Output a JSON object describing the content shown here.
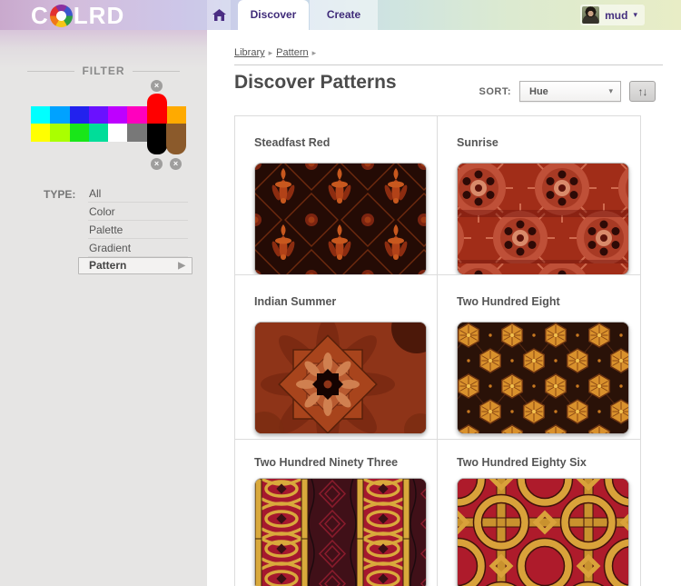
{
  "colors": {
    "accent_purple": "#3f2b79",
    "sidebar_bg": "#e6e5e4",
    "header_gradient": [
      "#c9a9cd",
      "#cdc6e8",
      "#c7d6ea",
      "#cfe4e0",
      "#e8edc6"
    ],
    "grid_border": "#dcdcdc"
  },
  "icons": {
    "close": "×",
    "dropdown_arrow": "▾",
    "user_arrow": "▾",
    "sort_direction": "↑↓",
    "breadcrumb_arrow": "▸",
    "submenu_arrow": "▶"
  },
  "header": {
    "logo_left": "C",
    "logo_right": "LRD",
    "tabs": [
      {
        "label": "Discover",
        "active": true
      },
      {
        "label": "Create",
        "active": false
      }
    ],
    "user": {
      "name": "mud"
    }
  },
  "sidebar": {
    "filter_title": "FILTER",
    "palette": {
      "row1": [
        "#00FFFF",
        "#00A2FF",
        "#2222EE",
        "#6A11FF",
        "#BE00FF",
        "#FF00BE",
        "#FF0000",
        "#FFAA00"
      ],
      "row2": [
        "#FFFF00",
        "#AAFF00",
        "#19E619",
        "#00DD99",
        "#FFFFFF",
        "#787878",
        "#000000",
        "#8B5A2B"
      ],
      "selected": [
        "#FF0000",
        "#000000",
        "#8B5A2B"
      ]
    },
    "type_label": "TYPE:",
    "type_items": [
      {
        "label": "All",
        "selected": false
      },
      {
        "label": "Color",
        "selected": false
      },
      {
        "label": "Palette",
        "selected": false
      },
      {
        "label": "Gradient",
        "selected": false
      },
      {
        "label": "Pattern",
        "selected": true
      }
    ]
  },
  "main": {
    "breadcrumb": [
      {
        "label": "Library"
      },
      {
        "label": "Pattern"
      }
    ],
    "title": "Discover Patterns",
    "sort": {
      "label": "SORT:",
      "value": "Hue"
    },
    "cards": [
      {
        "title": "Steadfast Red",
        "colors": [
          "#240b05",
          "#6e2a0e",
          "#b24218",
          "#c8581e"
        ]
      },
      {
        "title": "Sunrise",
        "colors": [
          "#a12d18",
          "#c25238",
          "#2e0a06",
          "#d98a6a"
        ]
      },
      {
        "title": "Indian Summer",
        "colors": [
          "#8e3418",
          "#a8441c",
          "#140301"
        ]
      },
      {
        "title": "Two Hundred Eight",
        "colors": [
          "#2a1208",
          "#d9912c",
          "#6e3410"
        ]
      },
      {
        "title": "Two Hundred Ninety Three",
        "colors": [
          "#a5182e",
          "#d9a93c",
          "#401018"
        ]
      },
      {
        "title": "Two Hundred Eighty Six",
        "colors": [
          "#ae1b2b",
          "#d9a23a",
          "#40120a"
        ]
      }
    ]
  }
}
